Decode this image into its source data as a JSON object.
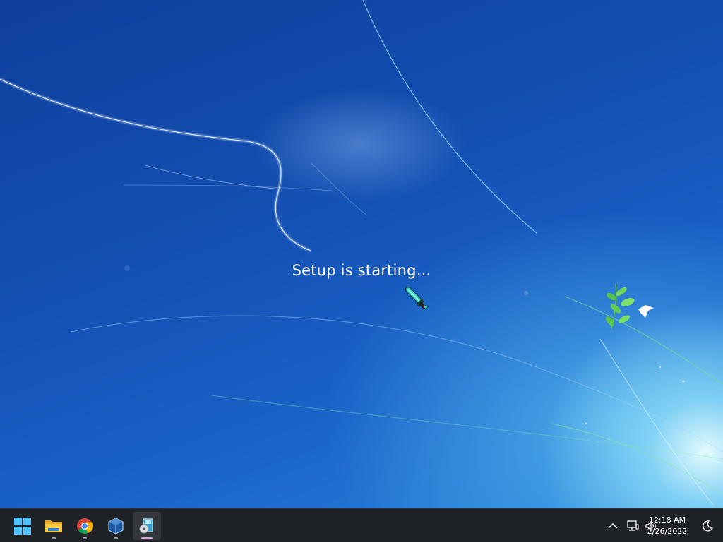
{
  "desktop": {
    "status_text": "Setup is starting..."
  },
  "taskbar": {
    "apps": [
      {
        "name": "start",
        "icon": "windows-logo-icon"
      },
      {
        "name": "file-explorer",
        "icon": "folder-icon"
      },
      {
        "name": "chrome",
        "icon": "chrome-icon"
      },
      {
        "name": "virtualbox",
        "icon": "virtualbox-icon"
      },
      {
        "name": "setup",
        "icon": "setup-disc-icon",
        "active": true
      }
    ]
  },
  "tray": {
    "icons": [
      "chevron-up-icon",
      "network-icon",
      "volume-icon",
      "focus-moon-icon"
    ],
    "time": "12:18 AM",
    "date": "2/26/2022"
  },
  "colors": {
    "taskbar_bg": "#1f2226",
    "wallpaper_blue": "#1450b3",
    "accent_blue": "#1a8fe0"
  }
}
